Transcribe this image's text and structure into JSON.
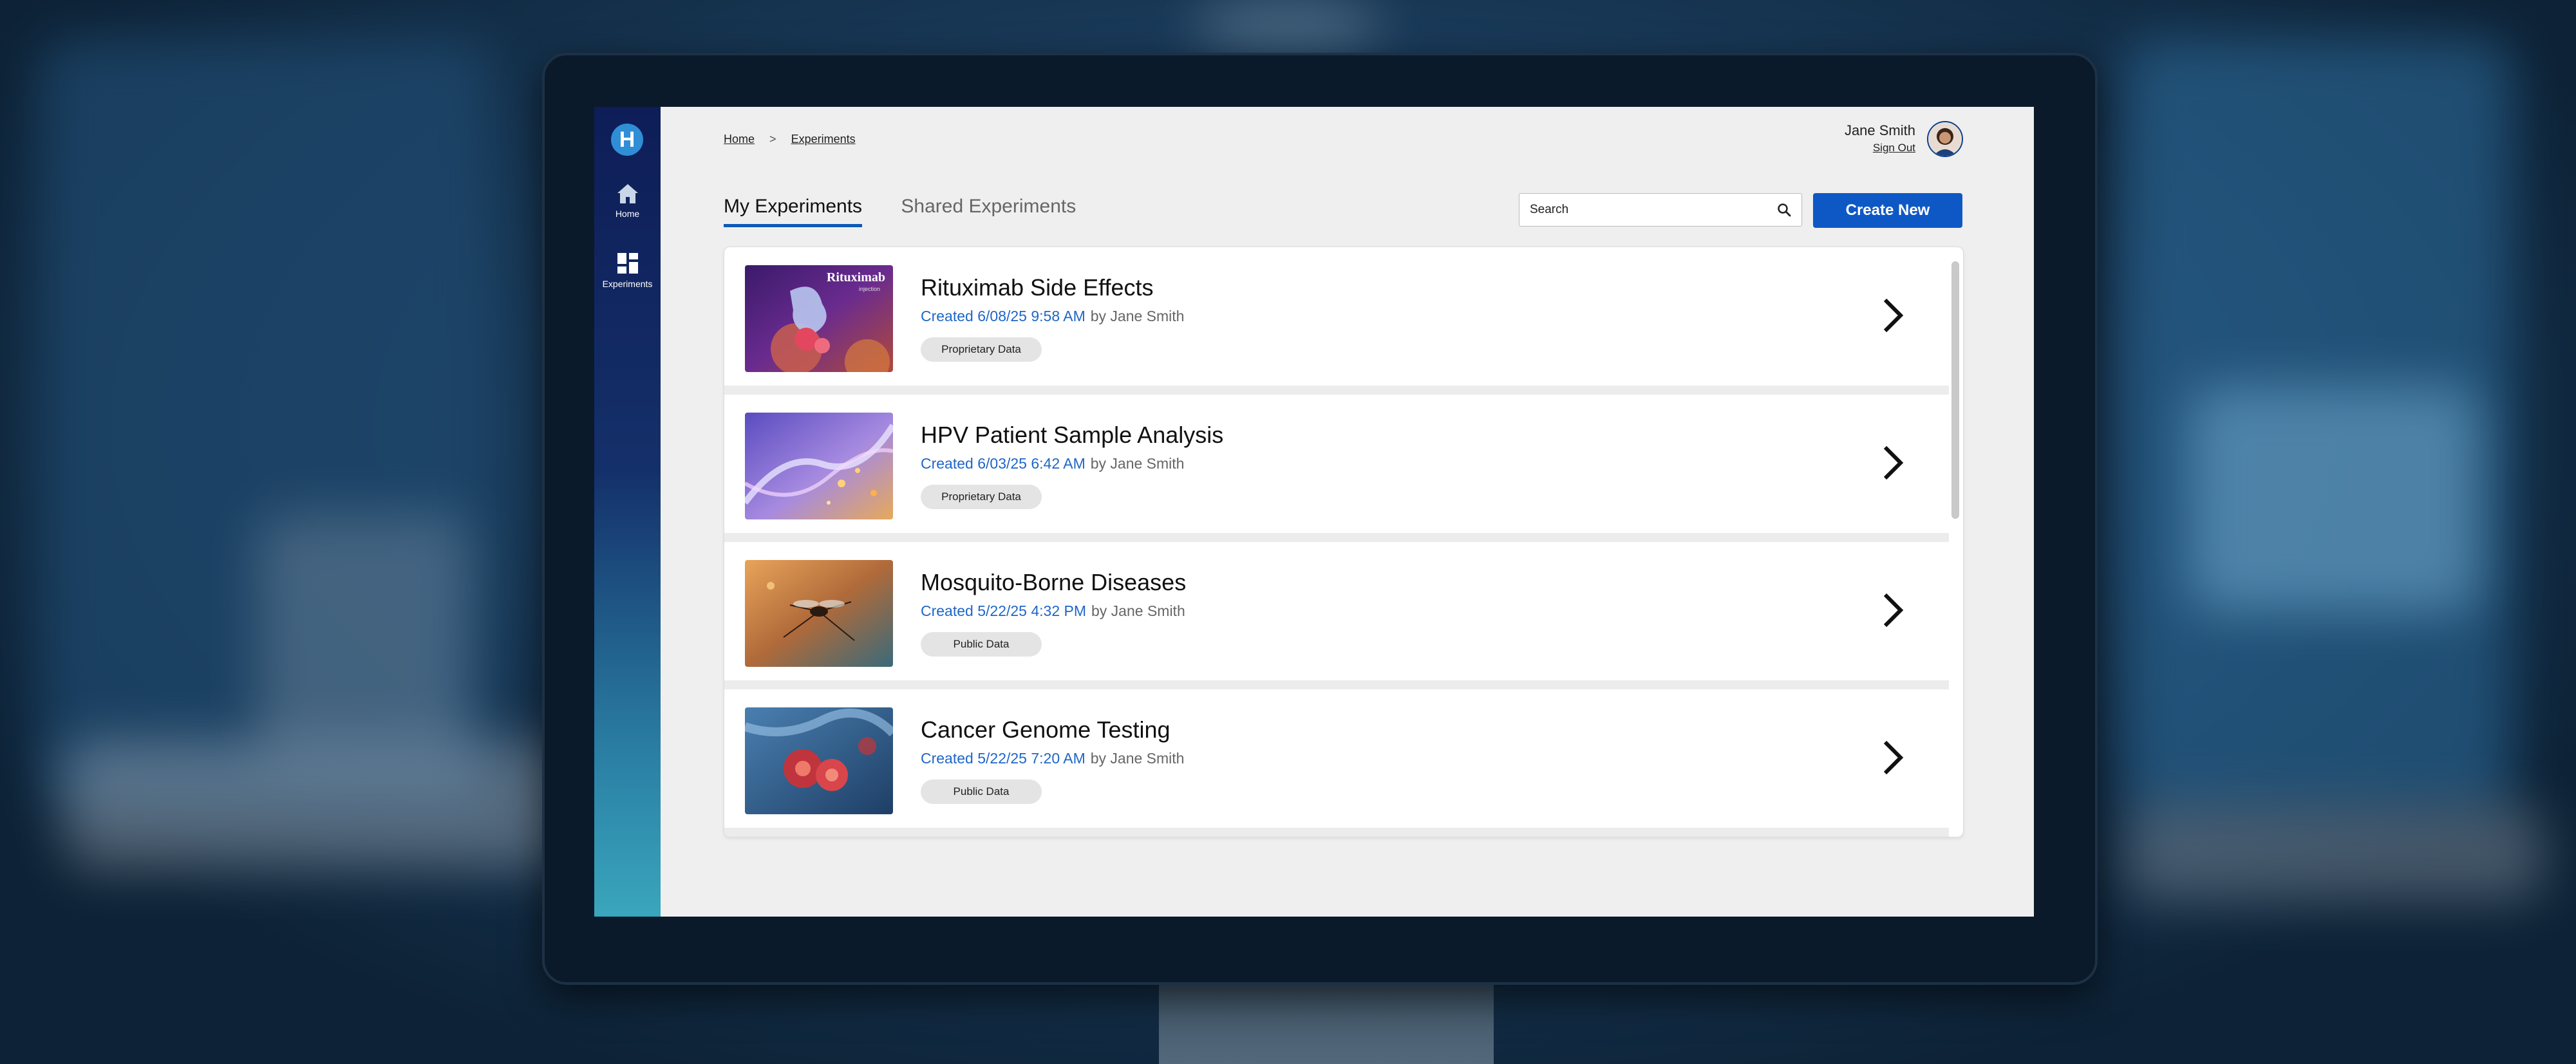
{
  "sidebar": {
    "logo_letter": "H",
    "items": [
      {
        "label": "Home",
        "icon": "home-icon"
      },
      {
        "label": "Experiments",
        "icon": "dashboard-icon"
      }
    ]
  },
  "breadcrumb": {
    "home": "Home",
    "separator": ">",
    "current": "Experiments"
  },
  "user": {
    "name": "Jane Smith",
    "sign_out": "Sign Out"
  },
  "tabs": [
    {
      "label": "My Experiments",
      "active": true
    },
    {
      "label": "Shared Experiments",
      "active": false
    }
  ],
  "search": {
    "placeholder": "Search"
  },
  "create_button": "Create New",
  "experiments": [
    {
      "title": "Rituximab Side Effects",
      "created": "Created 6/08/25 9:58 AM",
      "author": "by Jane Smith",
      "tag": "Proprietary Data",
      "thumb_text": "Rituximab",
      "thumb_subtext": "injection"
    },
    {
      "title": "HPV Patient Sample Analysis",
      "created": "Created 6/03/25 6:42 AM",
      "author": "by Jane Smith",
      "tag": "Proprietary Data"
    },
    {
      "title": "Mosquito-Borne Diseases",
      "created": "Created 5/22/25 4:32 PM",
      "author": "by Jane Smith",
      "tag": "Public Data"
    },
    {
      "title": "Cancer Genome Testing",
      "created": "Created 5/22/25 7:20 AM",
      "author": "by Jane Smith",
      "tag": "Public Data"
    }
  ],
  "colors": {
    "accent": "#0e58c6",
    "date_link": "#1f66c7",
    "sidebar_top": "#0e1d57",
    "sidebar_bottom": "#3aa6bd",
    "page_bg": "#efefef"
  }
}
